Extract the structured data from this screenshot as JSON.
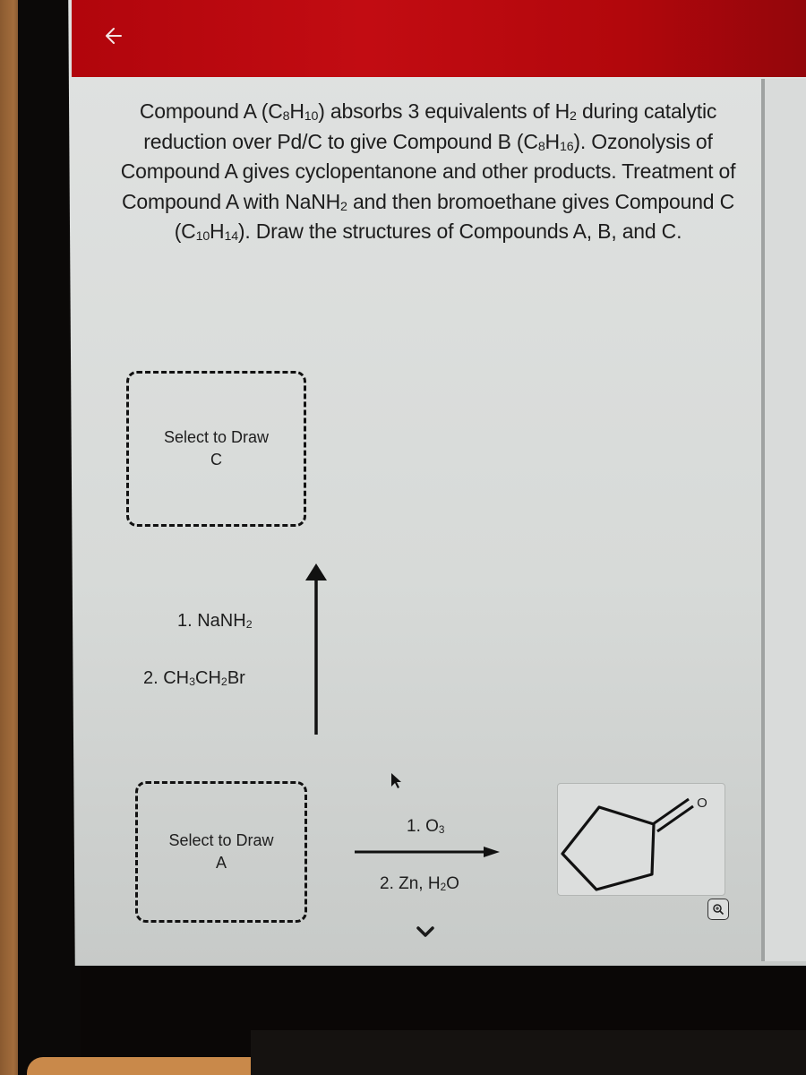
{
  "header": {
    "back_icon": "arrow-left-icon",
    "color": "#b8090f"
  },
  "question": {
    "parts": [
      {
        "t": "Compound A (C"
      },
      {
        "s": "8"
      },
      {
        "t": "H"
      },
      {
        "s": "10"
      },
      {
        "t": ") absorbs 3 equivalents of H"
      },
      {
        "s": "2"
      },
      {
        "t": " during catalytic reduction over Pd/C to give Compound B (C"
      },
      {
        "s": "8"
      },
      {
        "t": "H"
      },
      {
        "s": "16"
      },
      {
        "t": "). Ozonolysis of Compound A gives cyclopentanone and other products. Treatment of Compound A with NaNH"
      },
      {
        "s": "2"
      },
      {
        "t": " and then bromoethane gives Compound C (C"
      },
      {
        "s": "10"
      },
      {
        "t": "H"
      },
      {
        "s": "14"
      },
      {
        "t": "). Draw the structures of Compounds A, B, and C."
      }
    ],
    "plain_text": "Compound A (C8H10) absorbs 3 equivalents of H2 during catalytic reduction over Pd/C to give Compound B (C8H16). Ozonolysis of Compound A gives cyclopentanone and other products. Treatment of Compound A with NaNH2 and then bromoethane gives Compound C (C10H14). Draw the structures of Compounds A, B, and C."
  },
  "draw_boxes": {
    "c": {
      "line1": "Select to Draw",
      "line2": "C"
    },
    "a": {
      "line1": "Select to Draw",
      "line2": "A"
    }
  },
  "reagents_vertical": {
    "step1": {
      "pre": "1. NaNH",
      "sub": "2",
      "post": ""
    },
    "step2": {
      "pre": "2. CH",
      "sub1": "3",
      "mid": "CH",
      "sub2": "2",
      "post": "Br"
    }
  },
  "reagents_horizontal": {
    "step1": {
      "pre": "1. O",
      "sub": "3"
    },
    "step2": {
      "pre": "2. Zn, H",
      "sub": "2",
      "post": "O"
    }
  },
  "product": {
    "name": "cyclopentanone",
    "atom_label": "O",
    "zoom_icon": "magnifier-icon"
  },
  "scroll": {
    "chevron_icon": "chevron-down-icon"
  }
}
